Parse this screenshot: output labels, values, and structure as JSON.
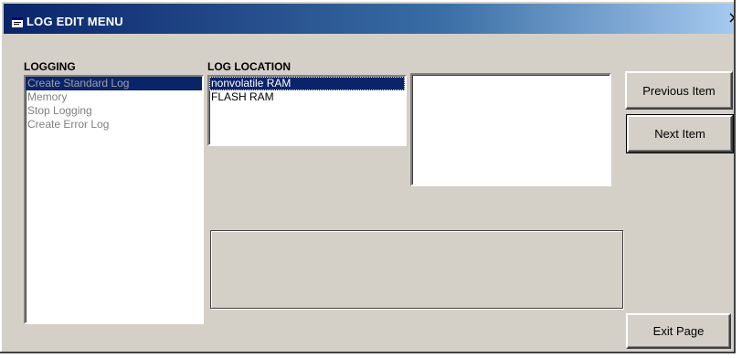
{
  "window": {
    "title": "LOG EDIT MENU",
    "close_glyph": "×",
    "title_icon": "window-app-icon"
  },
  "logging": {
    "label": "LOGGING",
    "items": [
      {
        "label": "Create Standard Log",
        "selected": true
      },
      {
        "label": "Memory",
        "selected": false
      },
      {
        "label": "Stop Logging",
        "selected": false
      },
      {
        "label": "Create Error Log",
        "selected": false
      }
    ]
  },
  "log_location": {
    "label": "LOG LOCATION",
    "items": [
      {
        "label": "nonvolatile RAM",
        "selected": true
      },
      {
        "label": "FLASH RAM",
        "selected": false
      }
    ]
  },
  "buttons": {
    "previous": "Previous Item",
    "next": "Next Item",
    "exit": "Exit Page"
  },
  "colors": {
    "face": "#d4d0c8",
    "selection": "#0a246a",
    "title_start": "#0a246a",
    "title_end": "#a6caf0"
  }
}
